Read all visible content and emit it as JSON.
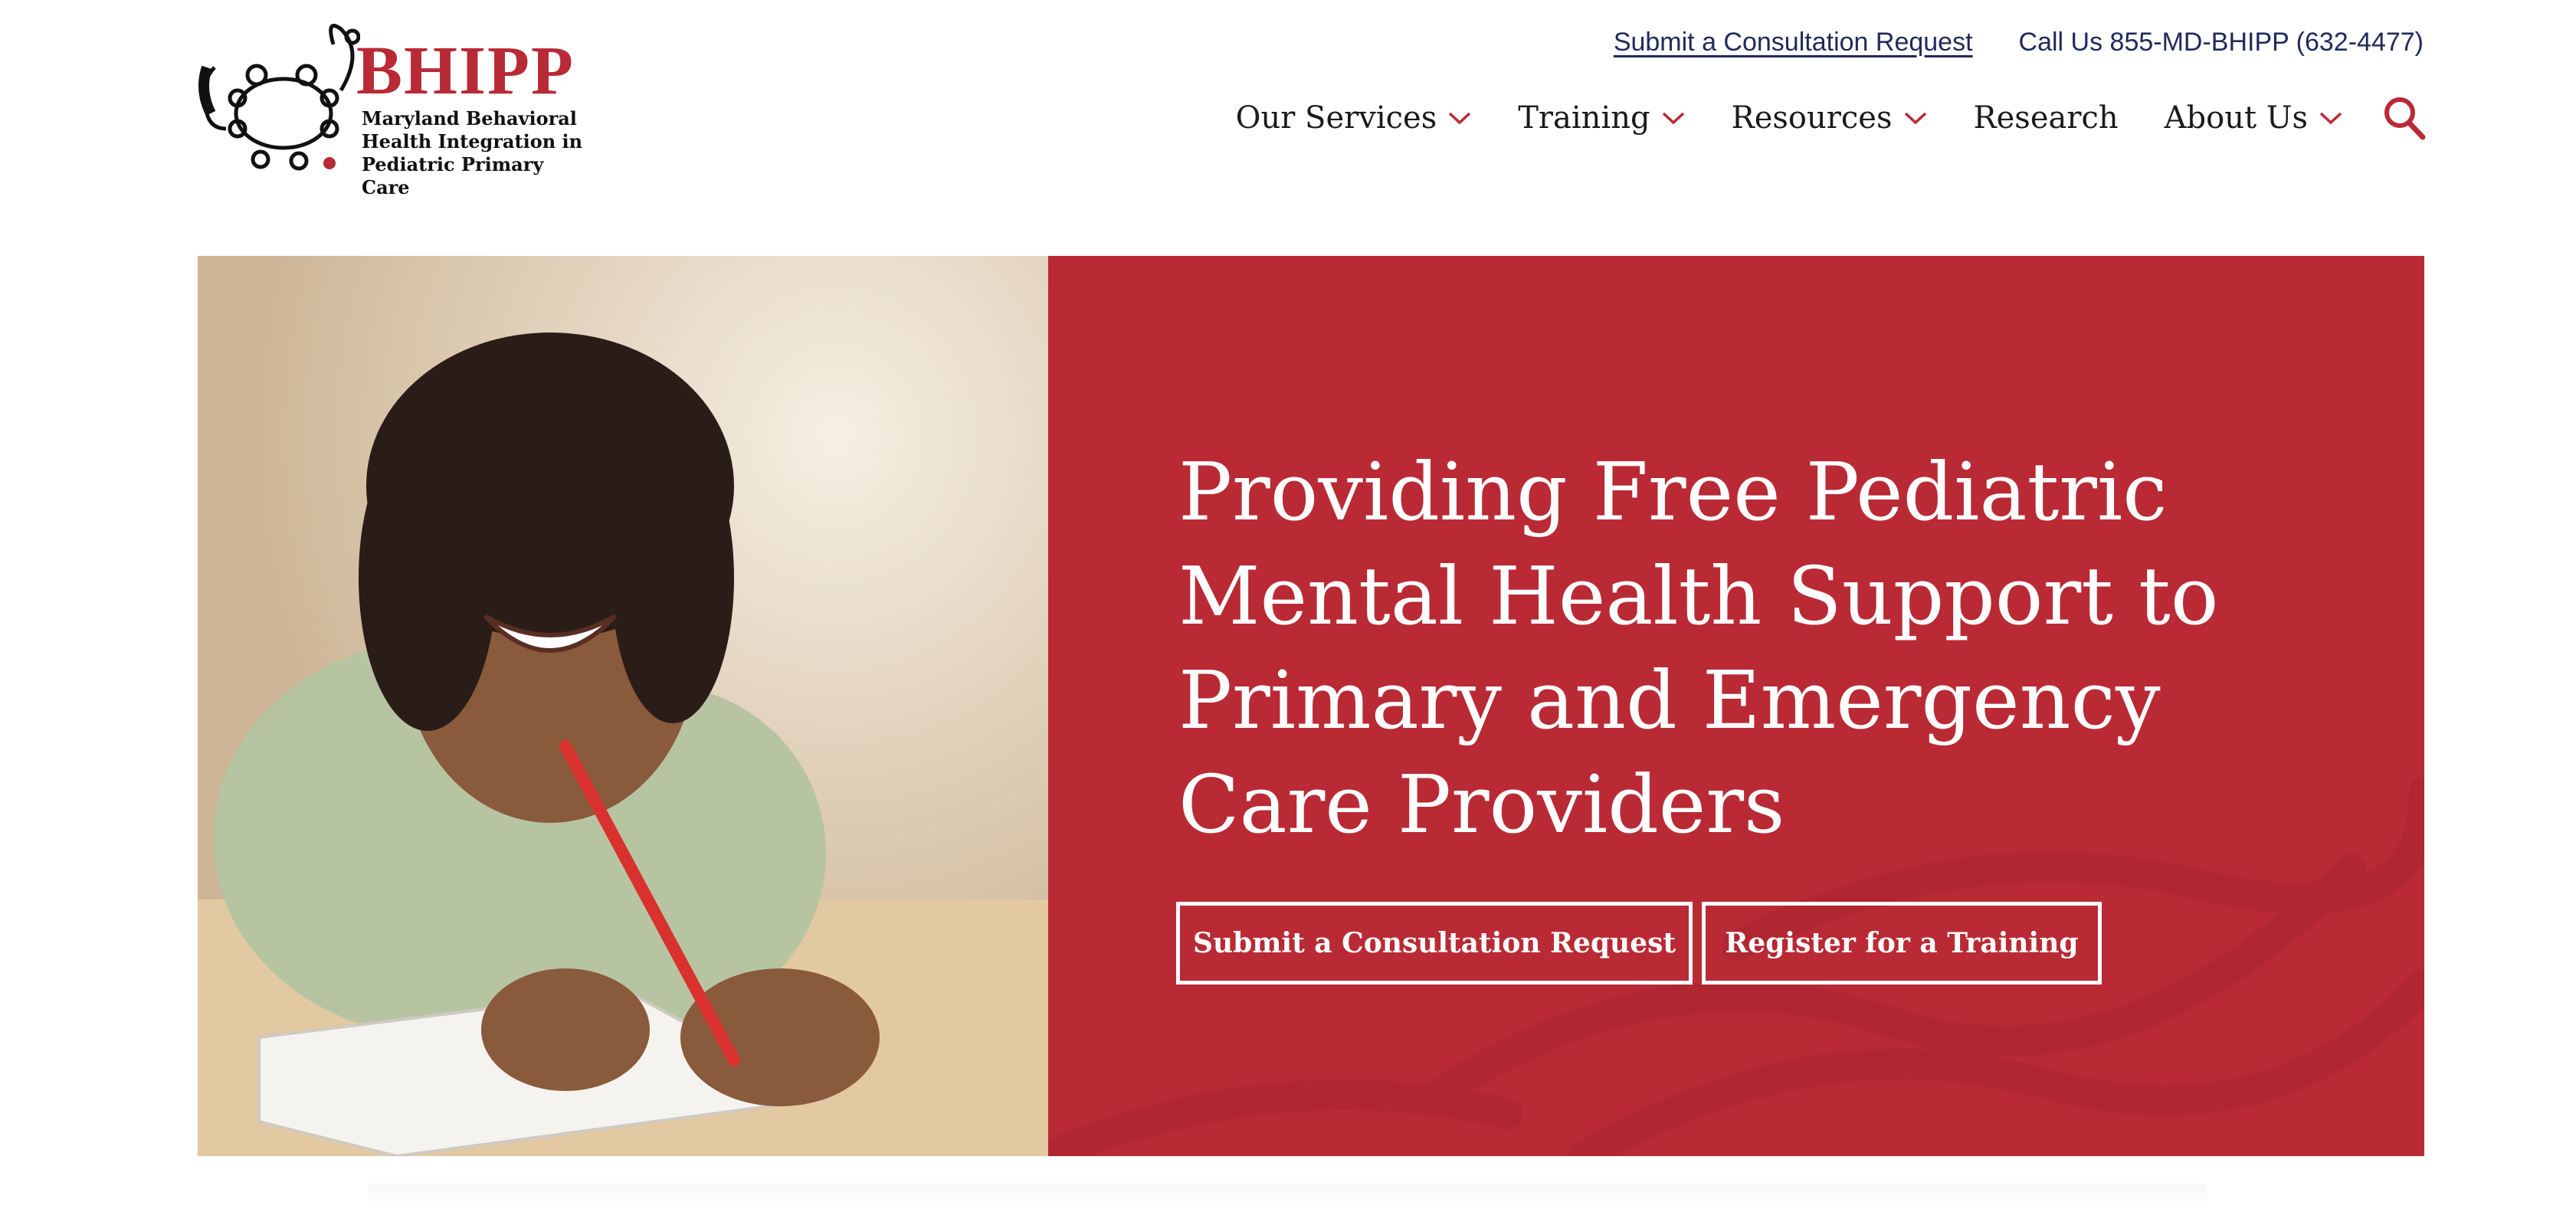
{
  "logo": {
    "title": "BHIPP",
    "subtitle": "Maryland Behavioral\nHealth Integration in\nPediatric Primary Care"
  },
  "utility": {
    "consultation_link": "Submit a Consultation Request",
    "phone": "Call Us 855-MD-BHIPP (632-4477)"
  },
  "nav": {
    "items": [
      {
        "label": "Our Services",
        "dropdown": true
      },
      {
        "label": "Training",
        "dropdown": true
      },
      {
        "label": "Resources",
        "dropdown": true
      },
      {
        "label": "Research",
        "dropdown": false
      },
      {
        "label": "About Us",
        "dropdown": true
      }
    ],
    "search_icon": "search-icon"
  },
  "hero": {
    "title": "Providing Free Pediatric Mental Health Support to Primary and Emergency Care Providers",
    "cta_primary": "Submit a Consultation Request",
    "cta_secondary": "Register for a Training",
    "photo_alt": "child-writing-photo"
  },
  "colors": {
    "brand_red": "#b92a35",
    "nav_text": "#1a1a1a",
    "utility_text": "#1f2a5a",
    "white": "#ffffff"
  }
}
